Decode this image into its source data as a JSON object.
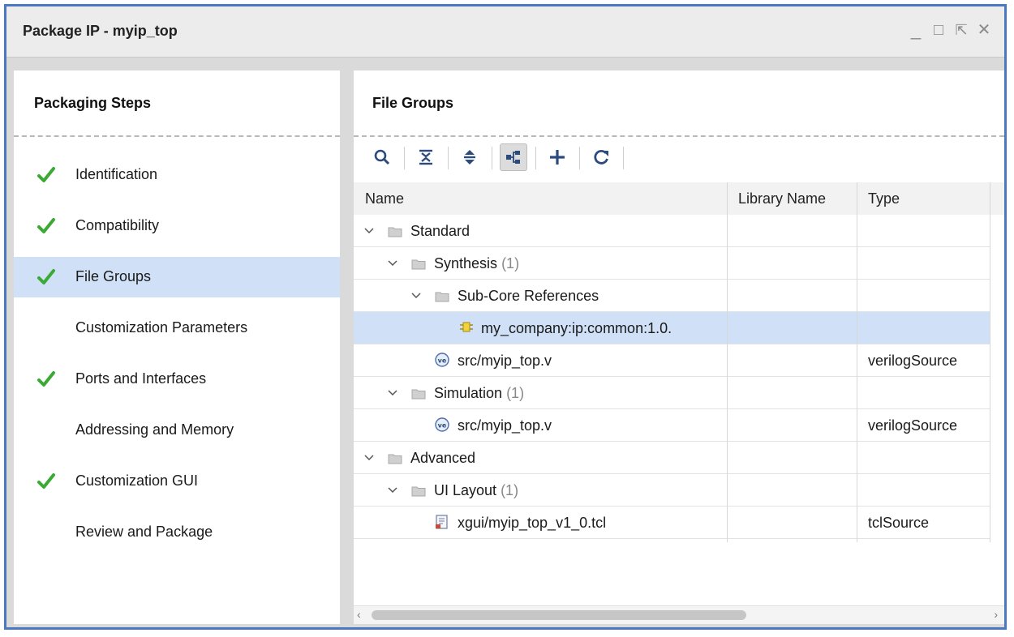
{
  "window": {
    "title": "Package IP - myip_top"
  },
  "window_controls": {
    "minimize": "_",
    "maximize": "□",
    "restore": "⇱",
    "close": "✕"
  },
  "steps_panel": {
    "heading": "Packaging Steps",
    "steps": [
      {
        "label": "Identification",
        "done": true,
        "selected": false
      },
      {
        "label": "Compatibility",
        "done": true,
        "selected": false
      },
      {
        "label": "File Groups",
        "done": true,
        "selected": true
      },
      {
        "label": "Customization Parameters",
        "done": false,
        "selected": false
      },
      {
        "label": "Ports and Interfaces",
        "done": true,
        "selected": false
      },
      {
        "label": "Addressing and Memory",
        "done": false,
        "selected": false
      },
      {
        "label": "Customization GUI",
        "done": true,
        "selected": false
      },
      {
        "label": "Review and Package",
        "done": false,
        "selected": false
      }
    ]
  },
  "file_groups_panel": {
    "heading": "File Groups",
    "toolbar": [
      "search-icon",
      "collapse-all-icon",
      "expand-all-icon",
      "hierarchy-icon",
      "add-icon",
      "refresh-icon"
    ],
    "columns": {
      "name": "Name",
      "library": "Library Name",
      "type": "Type"
    },
    "rows": [
      {
        "name": "Standard",
        "count": "",
        "library": "",
        "type": "",
        "depth": 0,
        "icon": "folder-icon",
        "expandable": true,
        "selected": false
      },
      {
        "name": "Synthesis",
        "count": "(1)",
        "library": "",
        "type": "",
        "depth": 1,
        "icon": "folder-icon",
        "expandable": true,
        "selected": false
      },
      {
        "name": "Sub-Core References",
        "count": "",
        "library": "",
        "type": "",
        "depth": 2,
        "icon": "folder-icon",
        "expandable": true,
        "selected": false
      },
      {
        "name": "my_company:ip:common:1.0.",
        "count": "",
        "library": "",
        "type": "",
        "depth": 3,
        "icon": "ip-core-icon",
        "expandable": false,
        "selected": true
      },
      {
        "name": "src/myip_top.v",
        "count": "",
        "library": "",
        "type": "verilogSource",
        "depth": 2,
        "icon": "verilog-file-icon",
        "expandable": false,
        "selected": false
      },
      {
        "name": "Simulation",
        "count": "(1)",
        "library": "",
        "type": "",
        "depth": 1,
        "icon": "folder-icon",
        "expandable": true,
        "selected": false
      },
      {
        "name": "src/myip_top.v",
        "count": "",
        "library": "",
        "type": "verilogSource",
        "depth": 2,
        "icon": "verilog-file-icon",
        "expandable": false,
        "selected": false
      },
      {
        "name": "Advanced",
        "count": "",
        "library": "",
        "type": "",
        "depth": 0,
        "icon": "folder-icon",
        "expandable": true,
        "selected": false
      },
      {
        "name": "UI Layout",
        "count": "(1)",
        "library": "",
        "type": "",
        "depth": 1,
        "icon": "folder-icon",
        "expandable": true,
        "selected": false
      },
      {
        "name": "xgui/myip_top_v1_0.tcl",
        "count": "",
        "library": "",
        "type": "tclSource",
        "depth": 2,
        "icon": "tcl-file-icon",
        "expandable": false,
        "selected": false
      }
    ]
  },
  "colors": {
    "accent": "#4a78c2",
    "selection": "#cfe0f7",
    "check": "#3aaa35"
  }
}
